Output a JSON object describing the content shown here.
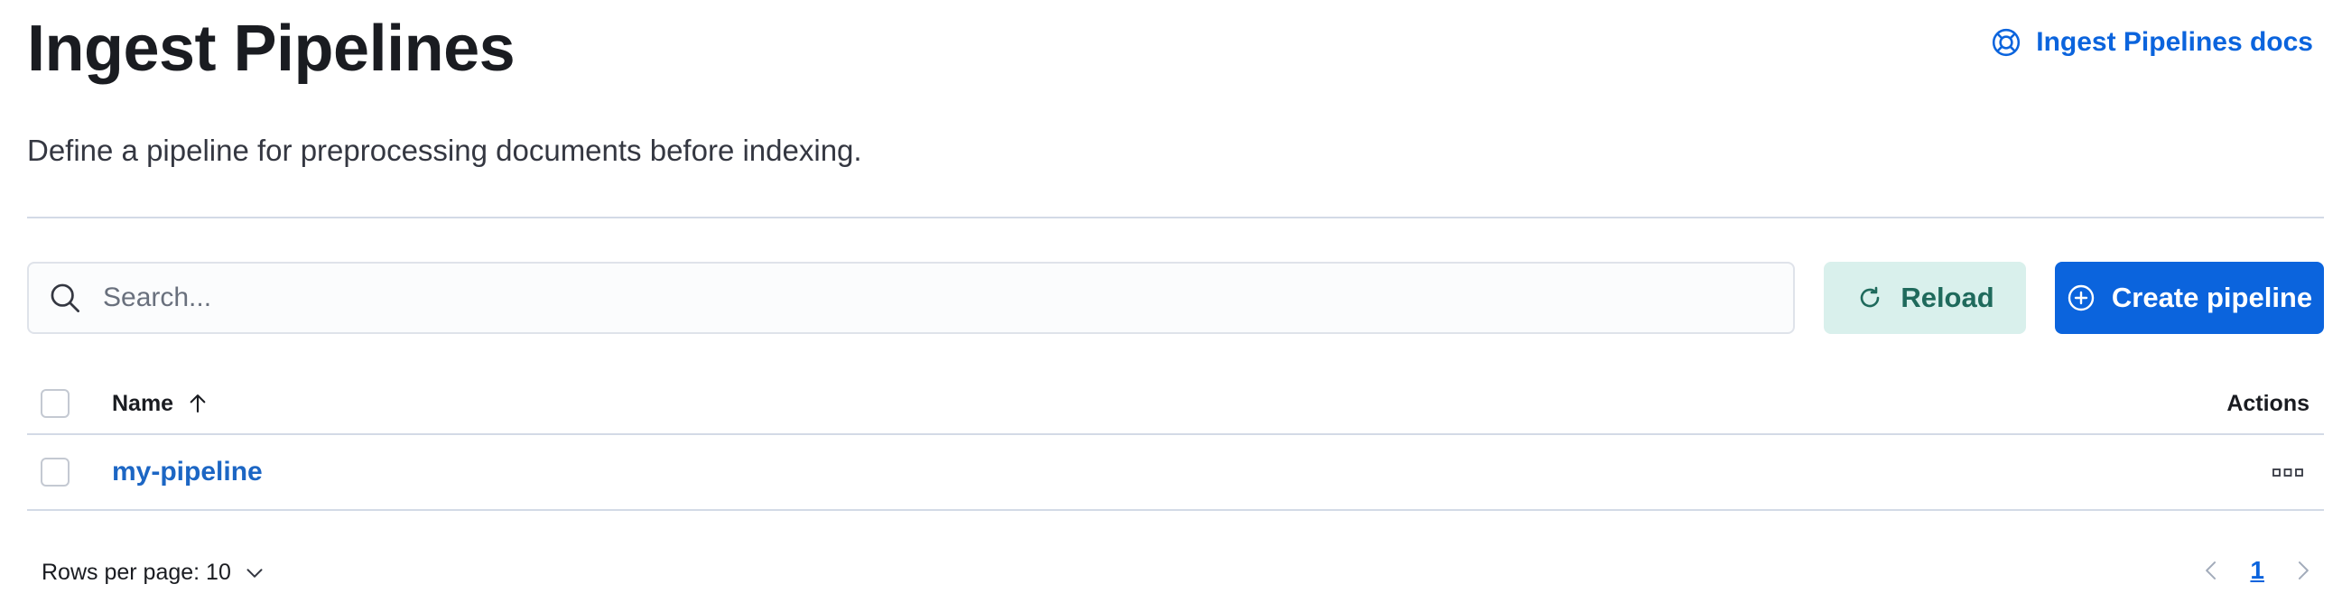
{
  "header": {
    "title": "Ingest Pipelines",
    "docs_link_label": "Ingest Pipelines docs",
    "description": "Define a pipeline for preprocessing documents before indexing."
  },
  "toolbar": {
    "search_placeholder": "Search...",
    "search_value": "",
    "reload_label": "Reload",
    "create_label": "Create pipeline"
  },
  "table": {
    "columns": {
      "name": "Name",
      "actions": "Actions"
    },
    "sort": "ascending",
    "rows": [
      {
        "name": "my-pipeline"
      }
    ]
  },
  "pagination": {
    "rows_per_page_label": "Rows per page: 10",
    "current_page": "1"
  },
  "colors": {
    "primary": "#0b64dd",
    "reload_bg": "#d9f0ec",
    "reload_text": "#1f6a5c",
    "link": "#1c66c4"
  },
  "icons": {
    "docs": "lifebuoy-icon",
    "search": "search-icon",
    "reload": "refresh-icon",
    "create": "plus-circle-icon",
    "sort": "arrow-up-icon",
    "row_actions": "boxes-horizontal-icon",
    "rows_dropdown": "chevron-down-icon",
    "prev": "chevron-left-icon",
    "next": "chevron-right-icon"
  }
}
